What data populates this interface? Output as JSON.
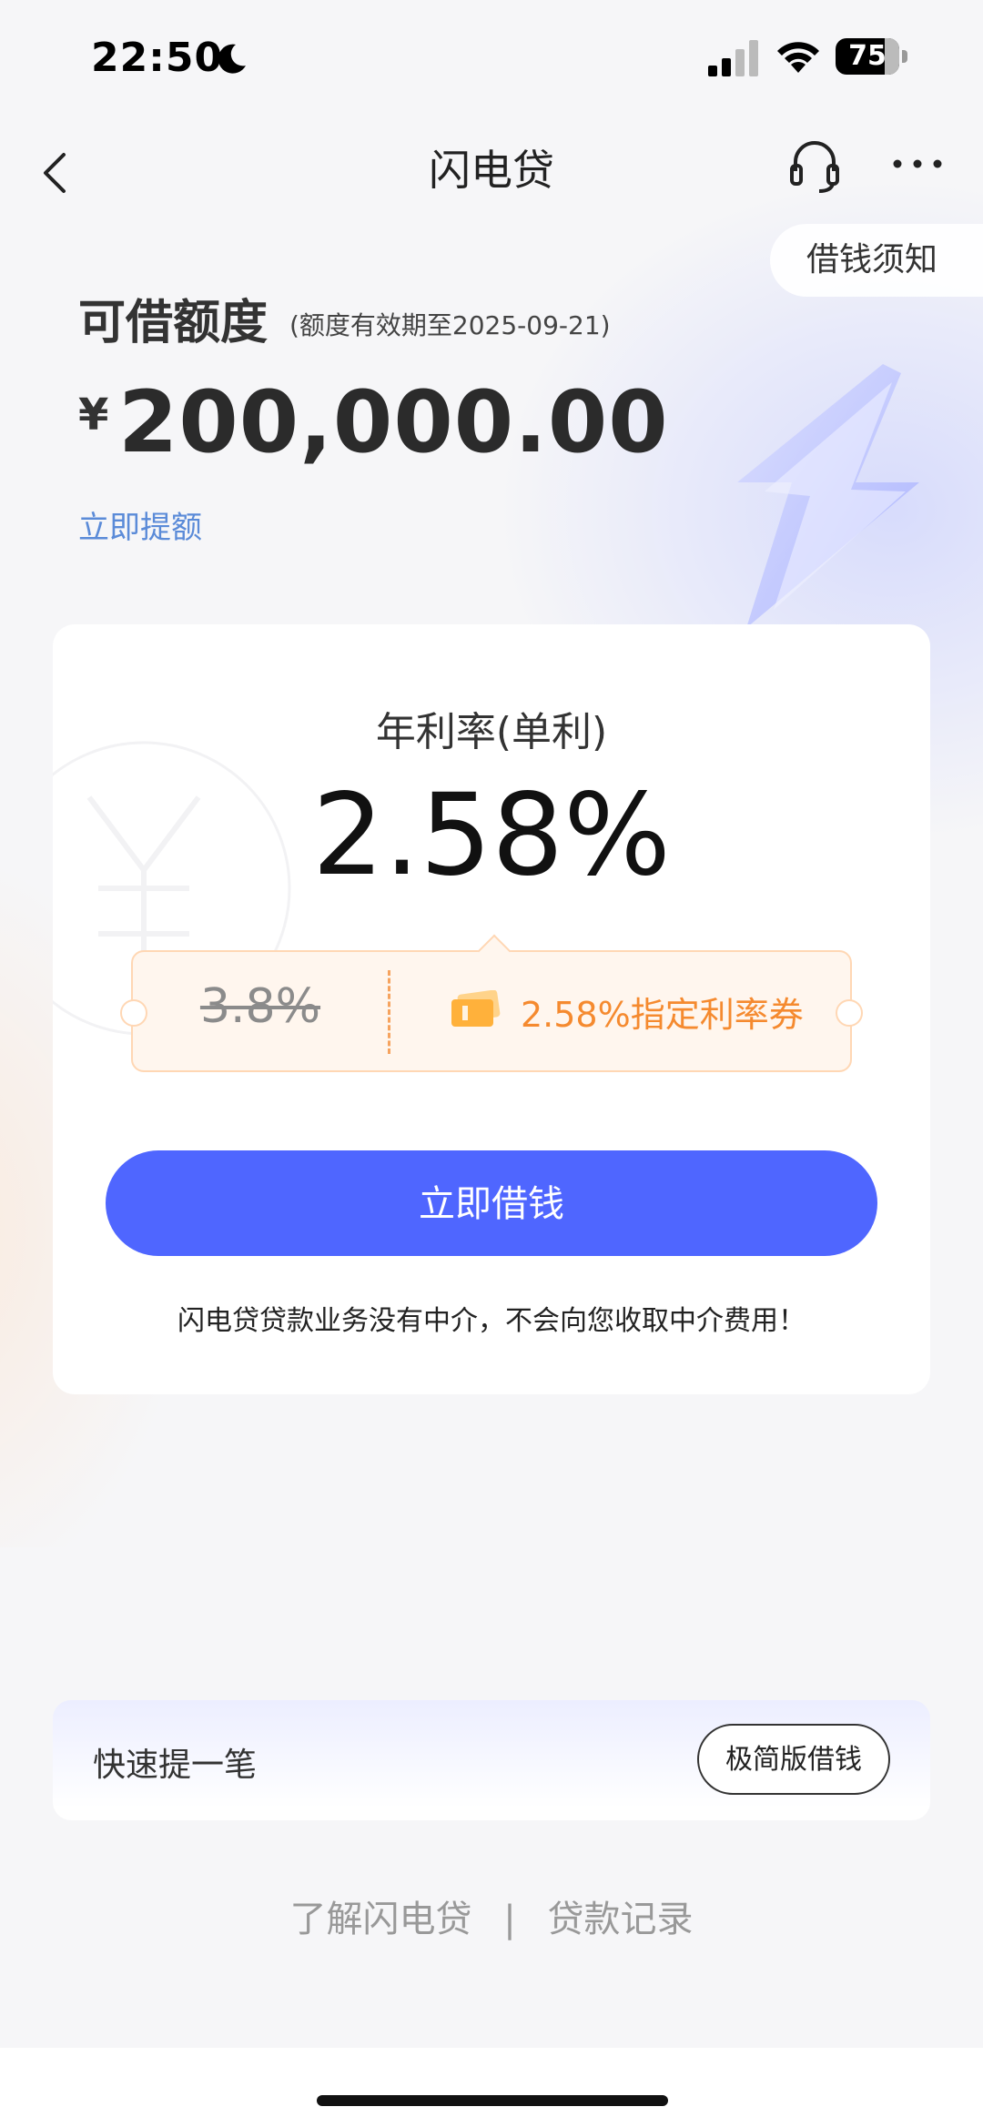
{
  "status_bar": {
    "time": "22:50",
    "battery": "75"
  },
  "nav": {
    "title": "闪电贷"
  },
  "notice_tab": "借钱须知",
  "credit": {
    "label": "可借额度",
    "validity": "(额度有效期至2025-09-21)",
    "currency": "¥",
    "amount": "200,000.00",
    "raise_link": "立即提额"
  },
  "rate_card": {
    "title": "年利率(单利)",
    "rate": "2.58%",
    "old_rate": "3.8%",
    "coupon_text": "2.58%指定利率券",
    "borrow_button": "立即借钱",
    "disclaimer": "闪电贷贷款业务没有中介，不会向您收取中介费用！"
  },
  "quick": {
    "label": "快速提一笔",
    "button": "极简版借钱"
  },
  "footer": {
    "link_about": "了解闪电贷",
    "separator": "|",
    "link_records": "贷款记录"
  },
  "colors": {
    "primary_button": "#4f66ff",
    "coupon_orange": "#f58a2f",
    "link_blue": "#5b8bd8"
  }
}
